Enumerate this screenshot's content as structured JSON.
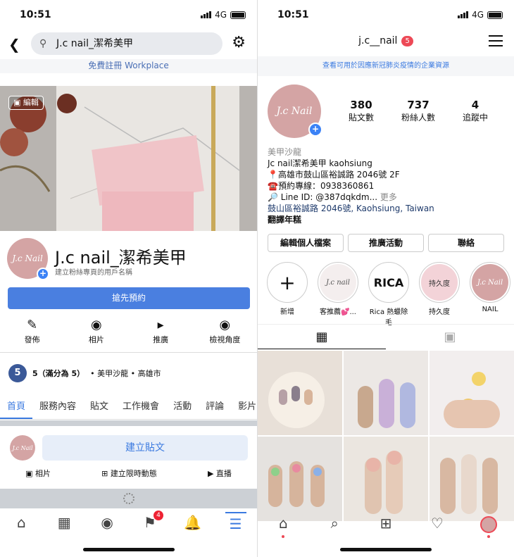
{
  "status": {
    "time": "10:51",
    "network": "4G"
  },
  "facebook": {
    "search_text": "J.c nail_潔希美甲",
    "workplace_banner": "免費註冊 Workplace",
    "cover_edit_label": "編輯",
    "page_name": "J.c nail_潔希美甲",
    "page_subtitle": "建立粉絲專頁的用戶名稱",
    "cta_label": "搶先預約",
    "actions": [
      {
        "label": "發佈",
        "icon": "edit-icon"
      },
      {
        "label": "相片",
        "icon": "camera-icon"
      },
      {
        "label": "推廣",
        "icon": "megaphone-icon"
      },
      {
        "label": "檢視角度",
        "icon": "eye-icon"
      }
    ],
    "rating": {
      "score": "5",
      "text": "5（滿分為 5）",
      "meta": "• 美甲沙龍 • 高雄市"
    },
    "tabs": [
      "首頁",
      "服務內容",
      "貼文",
      "工作機會",
      "活動",
      "評論",
      "影片"
    ],
    "active_tab": "首頁",
    "create_post_label": "建立貼文",
    "post_options": [
      {
        "label": "相片",
        "icon": "photo-icon"
      },
      {
        "label": "建立限時動態",
        "icon": "story-plus-icon"
      },
      {
        "label": "直播",
        "icon": "live-video-icon"
      }
    ],
    "bottom_nav": [
      {
        "icon": "home-icon",
        "glyph": "⌂"
      },
      {
        "icon": "shop-icon",
        "glyph": "▦"
      },
      {
        "icon": "groups-icon",
        "glyph": "◉"
      },
      {
        "icon": "flag-icon",
        "glyph": "⚑",
        "badge": "4"
      },
      {
        "icon": "bell-icon",
        "glyph": "♫"
      },
      {
        "icon": "menu-icon",
        "glyph": "☰"
      }
    ]
  },
  "instagram": {
    "username": "j.c__nail",
    "username_badge": "5",
    "covid_banner": "查看可用於因應新冠肺炎疫情的企業資源",
    "stats": [
      {
        "count": "380",
        "label": "貼文數"
      },
      {
        "count": "737",
        "label": "粉絲人數"
      },
      {
        "count": "4",
        "label": "追蹤中"
      }
    ],
    "bio": {
      "category": "美甲沙龍",
      "line1": "Jc nail潔希美甲 kaohsiung",
      "line2": "📍高雄市鼓山區裕誠路 2046號 2F",
      "line3": "☎️預約專線：0938360861",
      "line4": "🔎 Line ID: @387dqkdm...",
      "more": "更多",
      "address_link": "鼓山區裕誠路 2046號, Kaohsiung, Taiwan",
      "translate": "翻譯年糕"
    },
    "buttons": [
      "編輯個人檔案",
      "推廣活動",
      "聯絡"
    ],
    "highlights": [
      {
        "label": "新增",
        "content": "+"
      },
      {
        "label": "客推薦💕...",
        "content": "J.c nail"
      },
      {
        "label": "Rica 熱蠟除毛",
        "content": "RICA"
      },
      {
        "label": "持久度",
        "content": "持久度"
      },
      {
        "label": "NAIL",
        "content": "J.c Nail"
      }
    ],
    "bottom_nav": [
      {
        "icon": "home-icon",
        "glyph": "⌂"
      },
      {
        "icon": "search-icon",
        "glyph": "⌕"
      },
      {
        "icon": "add-post-icon",
        "glyph": "⊞"
      },
      {
        "icon": "heart-icon",
        "glyph": "♡"
      },
      {
        "icon": "profile-icon",
        "glyph": "●"
      }
    ]
  },
  "brand_colors": {
    "fb_blue": "#4a7fe0",
    "ig_badge": "#ed4956",
    "avatar_pink": "#d4a4a4"
  }
}
